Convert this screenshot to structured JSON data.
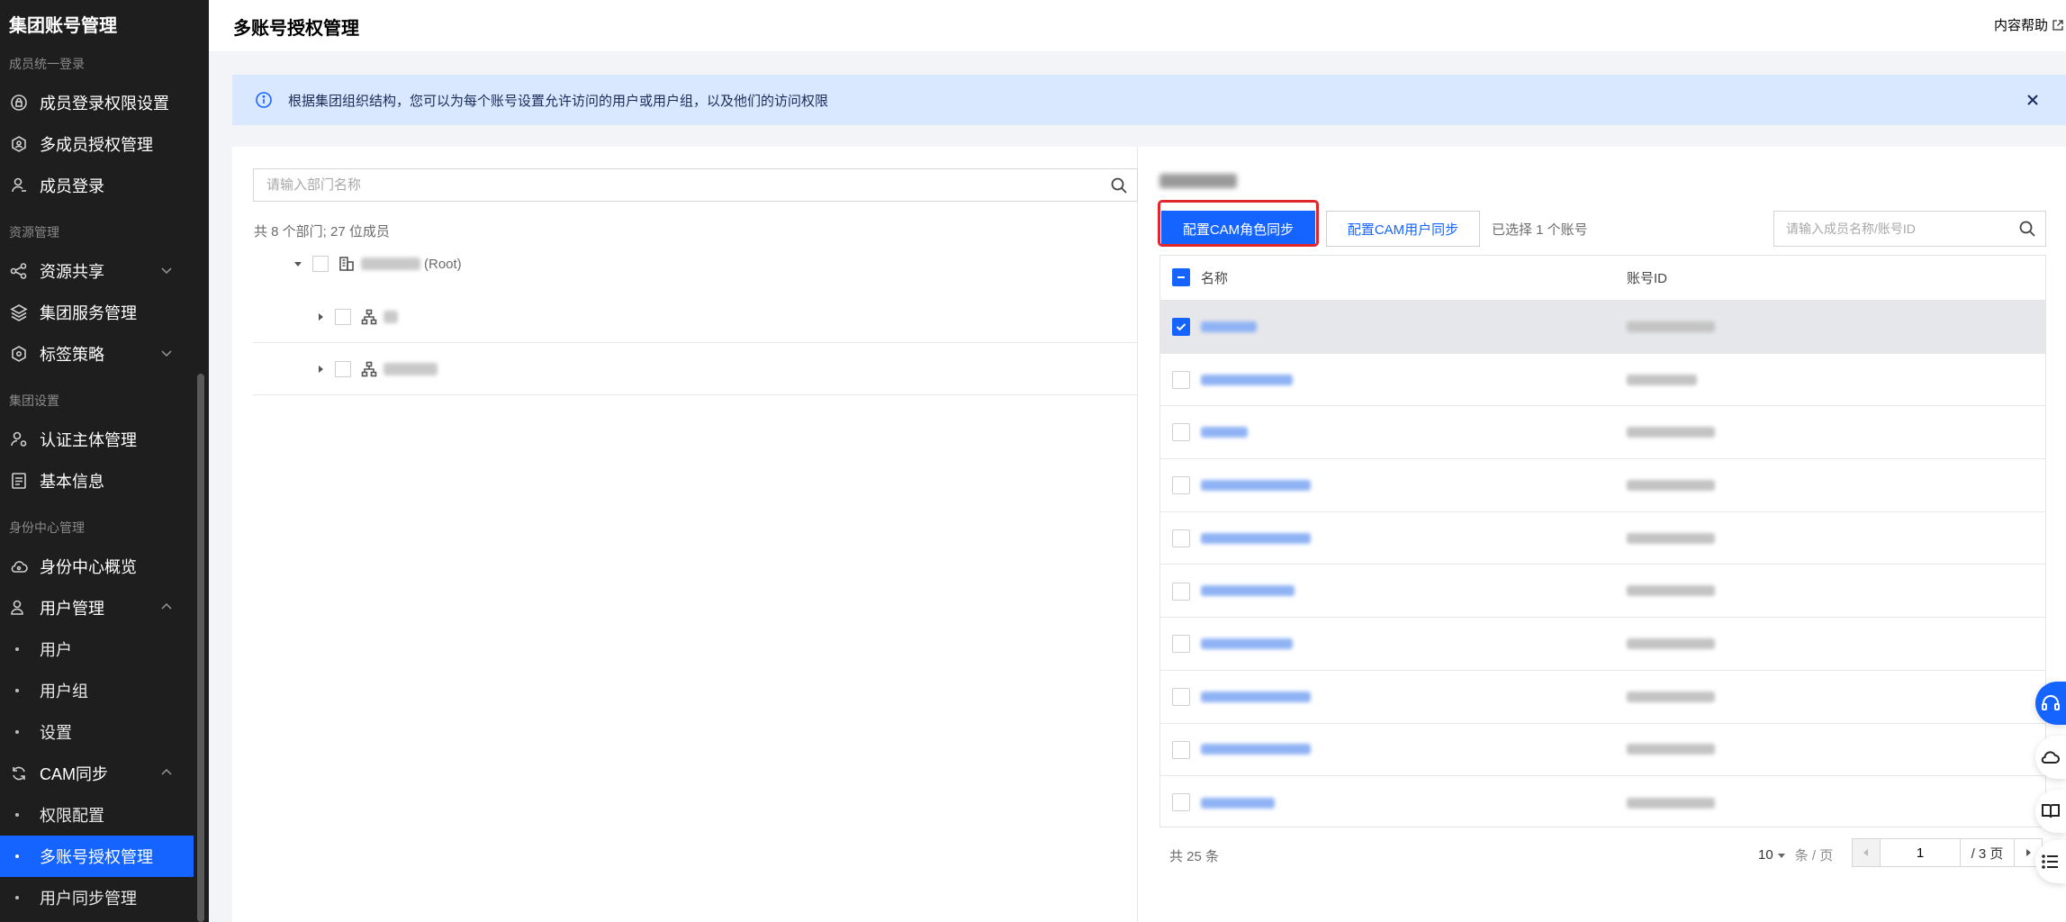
{
  "sidebar": {
    "title": "集团账号管理",
    "groups": {
      "member_login": "成员统一登录",
      "resource": "资源管理",
      "group_settings": "集团设置",
      "identity": "身份中心管理"
    },
    "items": {
      "member_login_perm": "成员登录权限设置",
      "multi_member_auth": "多成员授权管理",
      "member_login": "成员登录",
      "resource_share": "资源共享",
      "group_service": "集团服务管理",
      "tag_policy": "标签策略",
      "auth_entity": "认证主体管理",
      "basic_info": "基本信息",
      "identity_overview": "身份中心概览",
      "user_mgmt": "用户管理",
      "cam_sync": "CAM同步"
    },
    "sub_items": {
      "user": "用户",
      "user_group": "用户组",
      "settings": "设置",
      "perm_config": "权限配置",
      "multi_account_auth": "多账号授权管理",
      "user_sync_mgmt": "用户同步管理"
    }
  },
  "header": {
    "title": "多账号授权管理",
    "help": "内容帮助"
  },
  "banner": {
    "text": "根据集团组织结构，您可以为每个账号设置允许访问的用户或用户组，以及他们的访问权限"
  },
  "left": {
    "search_placeholder": "请输入部门名称",
    "count_text": "共 8 个部门; 27 位成员",
    "root_suffix": "(Root)"
  },
  "right": {
    "btn_role_sync": "配置CAM角色同步",
    "btn_user_sync": "配置CAM用户同步",
    "selected_text": "已选择 1 个账号",
    "search_placeholder": "请输入成员名称/账号ID",
    "col_name": "名称",
    "col_id": "账号ID",
    "total_text": "共 25 条",
    "page_size": "10",
    "page_size_unit": "条 / 页",
    "page_current": "1",
    "page_total": "/ 3 页"
  },
  "colors": {
    "accent": "#1664ff",
    "sidebar_bg": "#1e1e1e",
    "highlight": "#e0252b",
    "banner_bg": "#d9e8ff"
  }
}
